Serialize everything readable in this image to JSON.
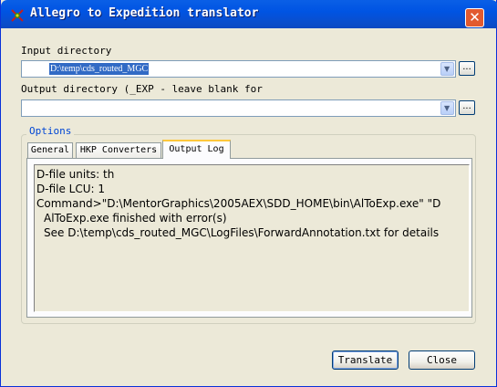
{
  "window": {
    "title": "Allegro to Expedition translator",
    "close_glyph": "✕"
  },
  "input": {
    "label": "Input directory",
    "value": "D:\\temp\\cds_routed_MGC",
    "browse_label": "..."
  },
  "output": {
    "label": "Output directory (_EXP - leave blank for",
    "value": "",
    "browse_label": "..."
  },
  "options": {
    "label": "Options",
    "tabs": [
      {
        "label": "General",
        "active": false
      },
      {
        "label": "HKP Converters",
        "active": false
      },
      {
        "label": "Output Log",
        "active": true
      }
    ],
    "log_lines": [
      "D-file units: th",
      "D-file LCU: 1",
      "Command>\"D:\\MentorGraphics\\2005AEX\\SDD_HOME\\bin\\AlToExp.exe\" \"D",
      "AlToExp.exe finished with error(s)",
      "See D:\\temp\\cds_routed_MGC\\LogFiles\\ForwardAnnotation.txt for details"
    ]
  },
  "buttons": {
    "translate": "Translate",
    "close": "Close"
  },
  "colors": {
    "titlebar": "#0054e3",
    "selection": "#316ac5",
    "background": "#ece9d8"
  }
}
